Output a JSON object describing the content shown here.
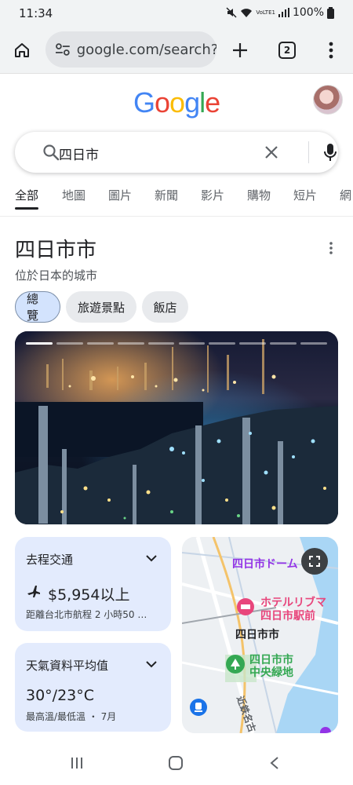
{
  "status_bar": {
    "time": "11:34",
    "signal_text": "VoLTE1",
    "battery": "100%"
  },
  "browser": {
    "url": "google.com/search?",
    "tab_count": "2"
  },
  "google": {
    "logo_letters": [
      {
        "ch": "G",
        "color": "#4285F4"
      },
      {
        "ch": "o",
        "color": "#EA4335"
      },
      {
        "ch": "o",
        "color": "#FBBC05"
      },
      {
        "ch": "g",
        "color": "#4285F4"
      },
      {
        "ch": "l",
        "color": "#34A853"
      },
      {
        "ch": "e",
        "color": "#EA4335"
      }
    ]
  },
  "search": {
    "query": "四日市"
  },
  "nav_tabs": [
    "全部",
    "地圖",
    "圖片",
    "新聞",
    "影片",
    "購物",
    "短片",
    "網"
  ],
  "knowledge_panel": {
    "title": "四日市市",
    "subtitle": "位於日本的城市",
    "chips": [
      "總覽",
      "旅遊景點",
      "飯店"
    ],
    "image_progress": {
      "segments": 10,
      "current": 1
    }
  },
  "cards": {
    "transport": {
      "title": "去程交通",
      "price": "$5,954以上",
      "detail": "距離台北市航程 2 小時50 …"
    },
    "weather": {
      "title": "天氣資料平均值",
      "temps": "30°/23°C",
      "detail": "最高溫/最低溫 ・ 7月"
    }
  },
  "map": {
    "labels": [
      "四日市ドーム",
      "ホテルリブマ",
      "四日市駅前",
      "四日市市",
      "四日市市",
      "中央緑地",
      "近鉄名古"
    ]
  },
  "colors": {
    "accent_blue": "#1a73e8",
    "card_bg": "#e3ebfd",
    "chip_active": "#d3e3fd",
    "map_pin_pink": "#e8467c",
    "map_pin_green": "#34a853",
    "map_label_purple": "#9334e6"
  }
}
